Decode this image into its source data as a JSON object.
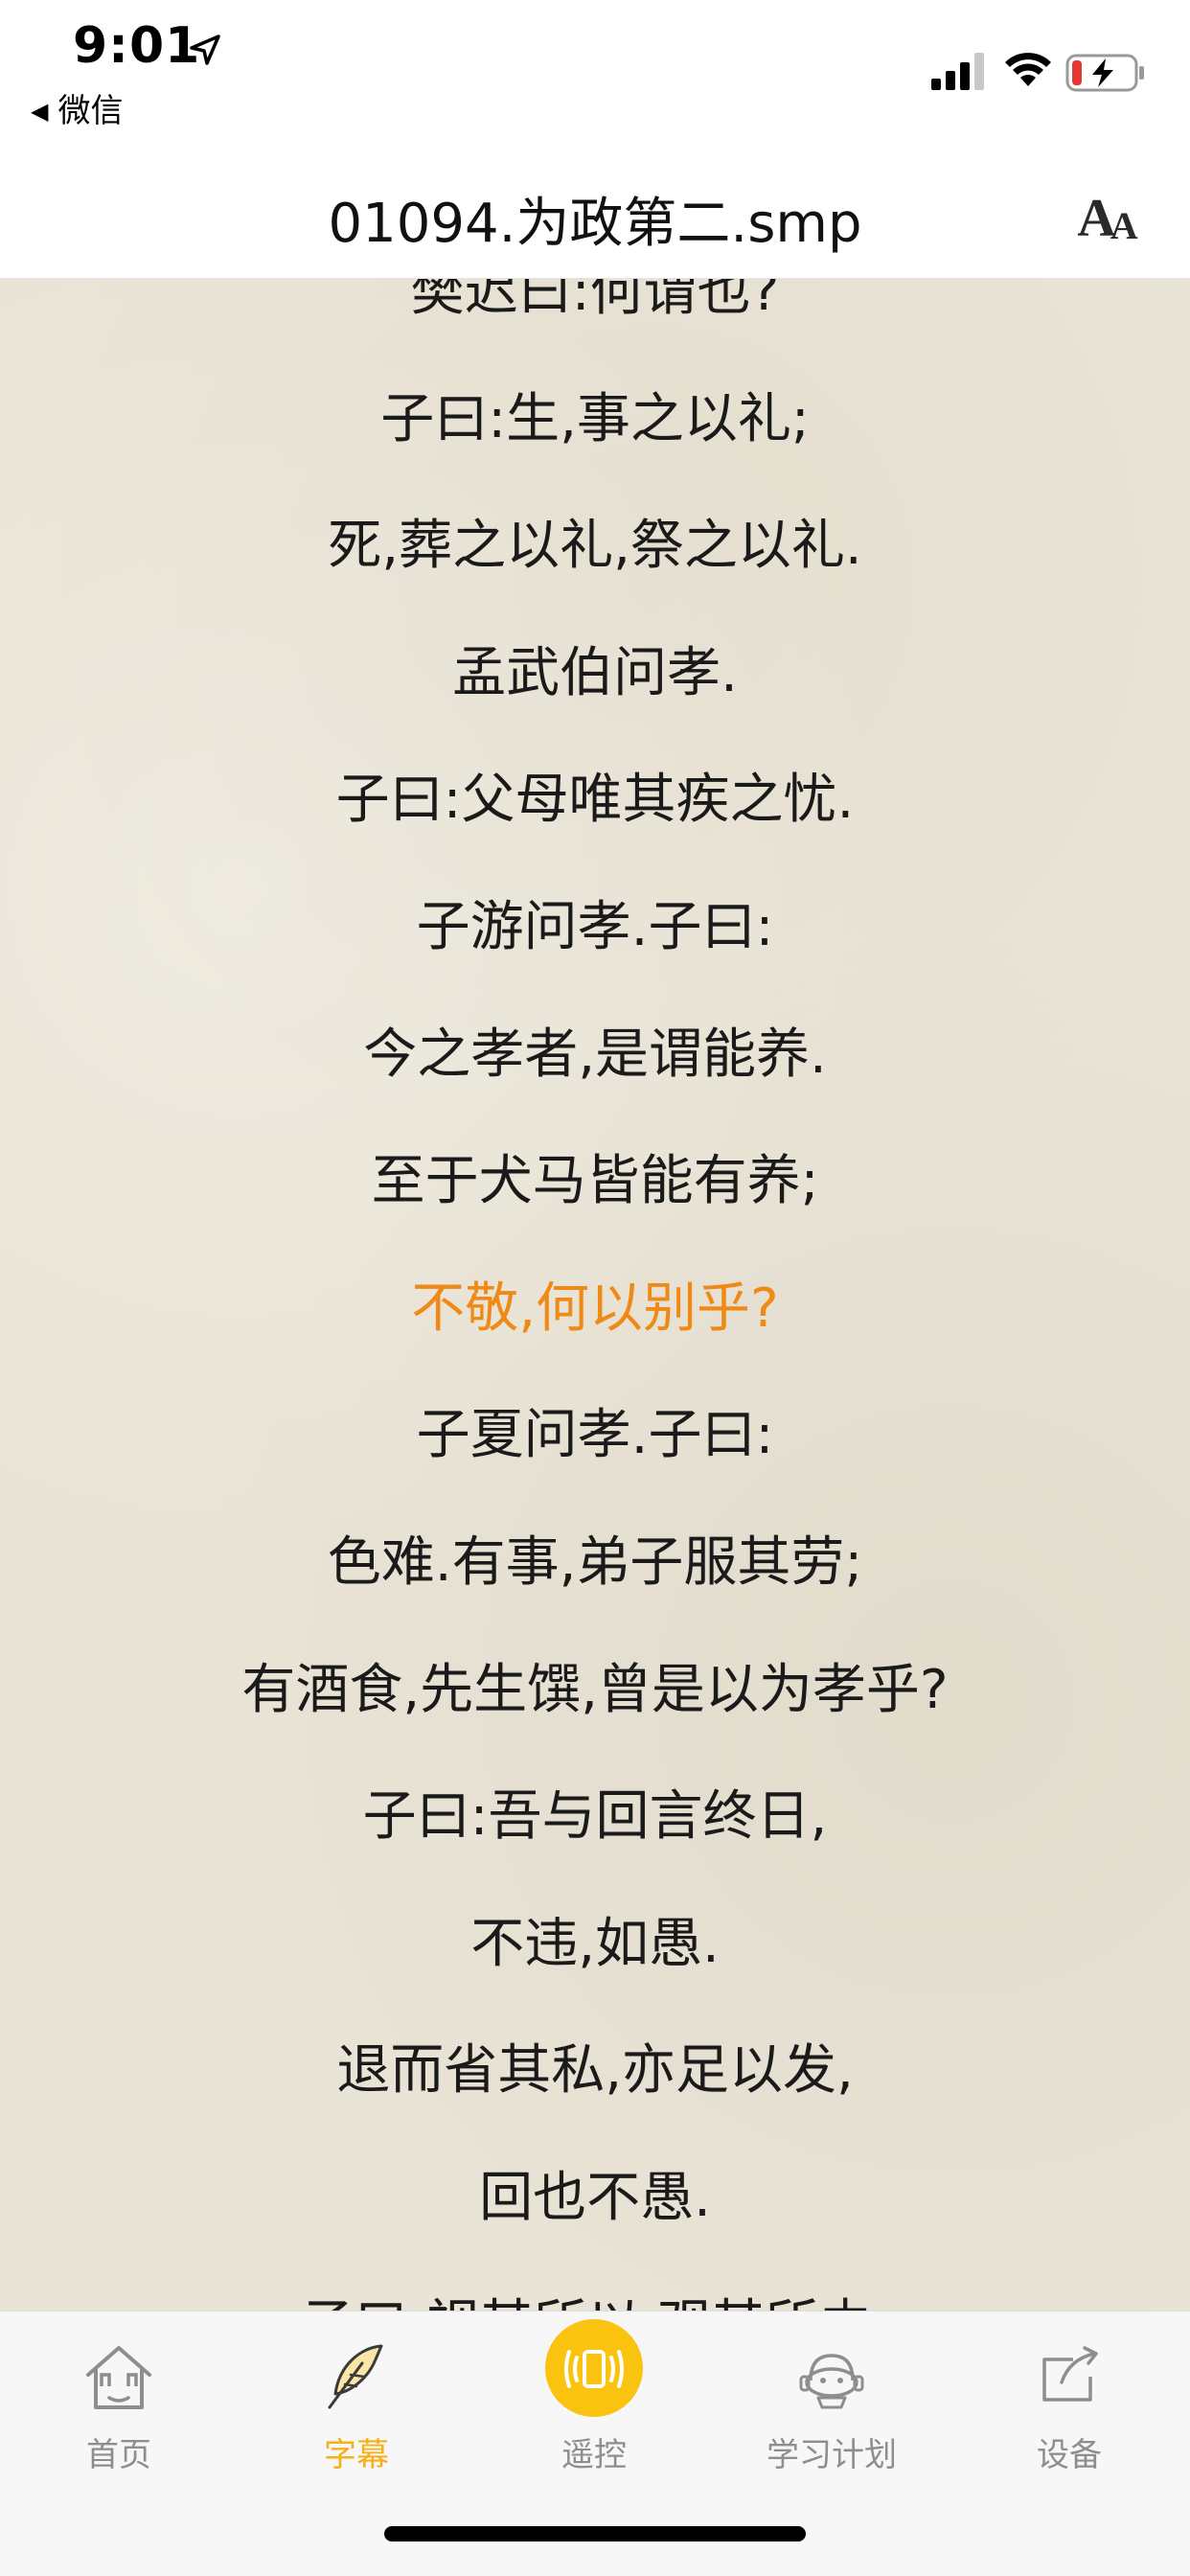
{
  "status_bar": {
    "time": "9:01",
    "back_app": "微信"
  },
  "nav": {
    "title": "01094.为政第二.smp",
    "font_button": "AA"
  },
  "lyrics": [
    "樊迟曰:何谓也?",
    "子曰:生,事之以礼;",
    "死,葬之以礼,祭之以礼.",
    "孟武伯问孝.",
    "子曰:父母唯其疾之忧.",
    "子游问孝.子曰:",
    "今之孝者,是谓能养.",
    "至于犬马皆能有养;",
    "不敬,何以别乎?",
    "子夏问孝.子曰:",
    "色难.有事,弟子服其劳;",
    "有酒食,先生馔,曾是以为孝乎?",
    "子曰:吾与回言终日,",
    "不违,如愚.",
    "退而省其私,亦足以发,",
    "回也不愚.",
    "子曰:视其所以,观其所由,"
  ],
  "current_line_index": 8,
  "colors": {
    "highlight": "#f08a17",
    "active_tab": "#f5b01a",
    "remote_button": "#f9c310",
    "paper": "#e9e4d6"
  },
  "tabs": [
    {
      "label": "首页",
      "icon": "home-icon"
    },
    {
      "label": "字幕",
      "icon": "feather-pen-icon"
    },
    {
      "label": "遥控",
      "icon": "remote-icon"
    },
    {
      "label": "学习计划",
      "icon": "study-robot-icon"
    },
    {
      "label": "设备",
      "icon": "device-share-icon"
    }
  ],
  "active_tab_index": 1
}
